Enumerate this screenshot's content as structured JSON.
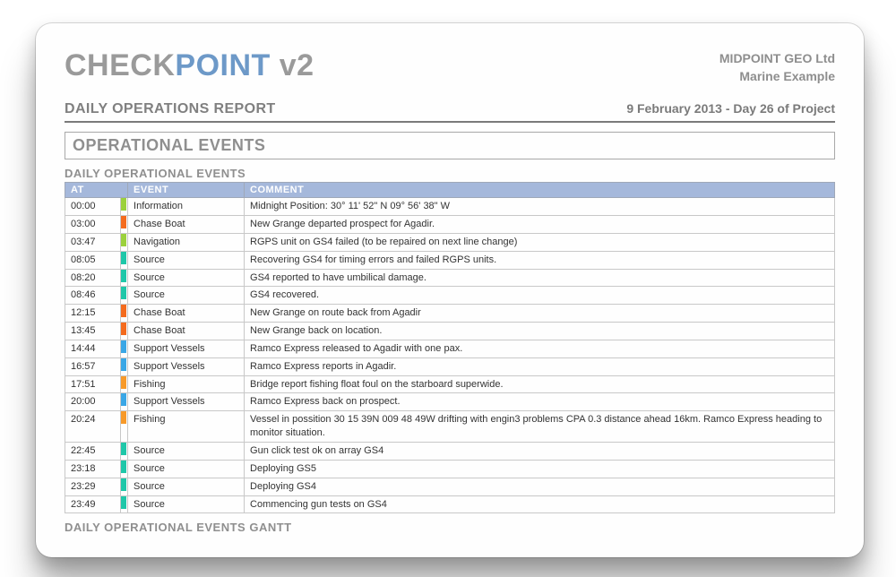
{
  "logo": {
    "seg1": "CHECK",
    "seg2": "POINT",
    "seg3": " v2"
  },
  "client": {
    "name": "MIDPOINT GEO Ltd",
    "project": "Marine Example"
  },
  "report_title": "DAILY OPERATIONS REPORT",
  "report_date": "9 February 2013 - Day 26 of Project",
  "section_title": "OPERATIONAL EVENTS",
  "subsection_title": "DAILY OPERATIONAL EVENTS",
  "gantt_title": "DAILY OPERATIONAL EVENTS GANTT",
  "columns": {
    "at": "AT",
    "event": "EVENT",
    "comment": "COMMENT"
  },
  "event_colors": {
    "Information": "#9bd13c",
    "Chase Boat": "#f46b1e",
    "Navigation": "#9bd13c",
    "Source": "#1fc7a9",
    "Support Vessels": "#3aa7e6",
    "Fishing": "#f79a2a"
  },
  "events": [
    {
      "at": "00:00",
      "event": "Information",
      "comment": "Midnight Position: 30° 11' 52\" N 09° 56' 38\" W"
    },
    {
      "at": "03:00",
      "event": "Chase Boat",
      "comment": "New Grange departed prospect for Agadir."
    },
    {
      "at": "03:47",
      "event": "Navigation",
      "comment": "RGPS unit on GS4 failed (to be repaired on next line change)"
    },
    {
      "at": "08:05",
      "event": "Source",
      "comment": "Recovering GS4 for timing errors and failed RGPS units."
    },
    {
      "at": "08:20",
      "event": "Source",
      "comment": "GS4 reported to have umbilical damage."
    },
    {
      "at": "08:46",
      "event": "Source",
      "comment": "GS4 recovered."
    },
    {
      "at": "12:15",
      "event": "Chase Boat",
      "comment": "New Grange on route back from Agadir"
    },
    {
      "at": "13:45",
      "event": "Chase Boat",
      "comment": "New Grange back on location."
    },
    {
      "at": "14:44",
      "event": "Support Vessels",
      "comment": "Ramco Express released to Agadir with one pax."
    },
    {
      "at": "16:57",
      "event": "Support Vessels",
      "comment": "Ramco Express reports in Agadir."
    },
    {
      "at": "17:51",
      "event": "Fishing",
      "comment": "Bridge report fishing float foul on the starboard superwide."
    },
    {
      "at": "20:00",
      "event": "Support Vessels",
      "comment": "Ramco Express back on prospect."
    },
    {
      "at": "20:24",
      "event": "Fishing",
      "comment": "Vessel in possition 30 15 39N 009 48 49W drifting with engin3 problems CPA 0.3 distance ahead 16km. Ramco Express heading to monitor situation."
    },
    {
      "at": "22:45",
      "event": "Source",
      "comment": "Gun click test ok on array GS4"
    },
    {
      "at": "23:18",
      "event": "Source",
      "comment": "Deploying GS5"
    },
    {
      "at": "23:29",
      "event": "Source",
      "comment": "Deploying GS4"
    },
    {
      "at": "23:49",
      "event": "Source",
      "comment": "Commencing gun tests on GS4"
    }
  ]
}
